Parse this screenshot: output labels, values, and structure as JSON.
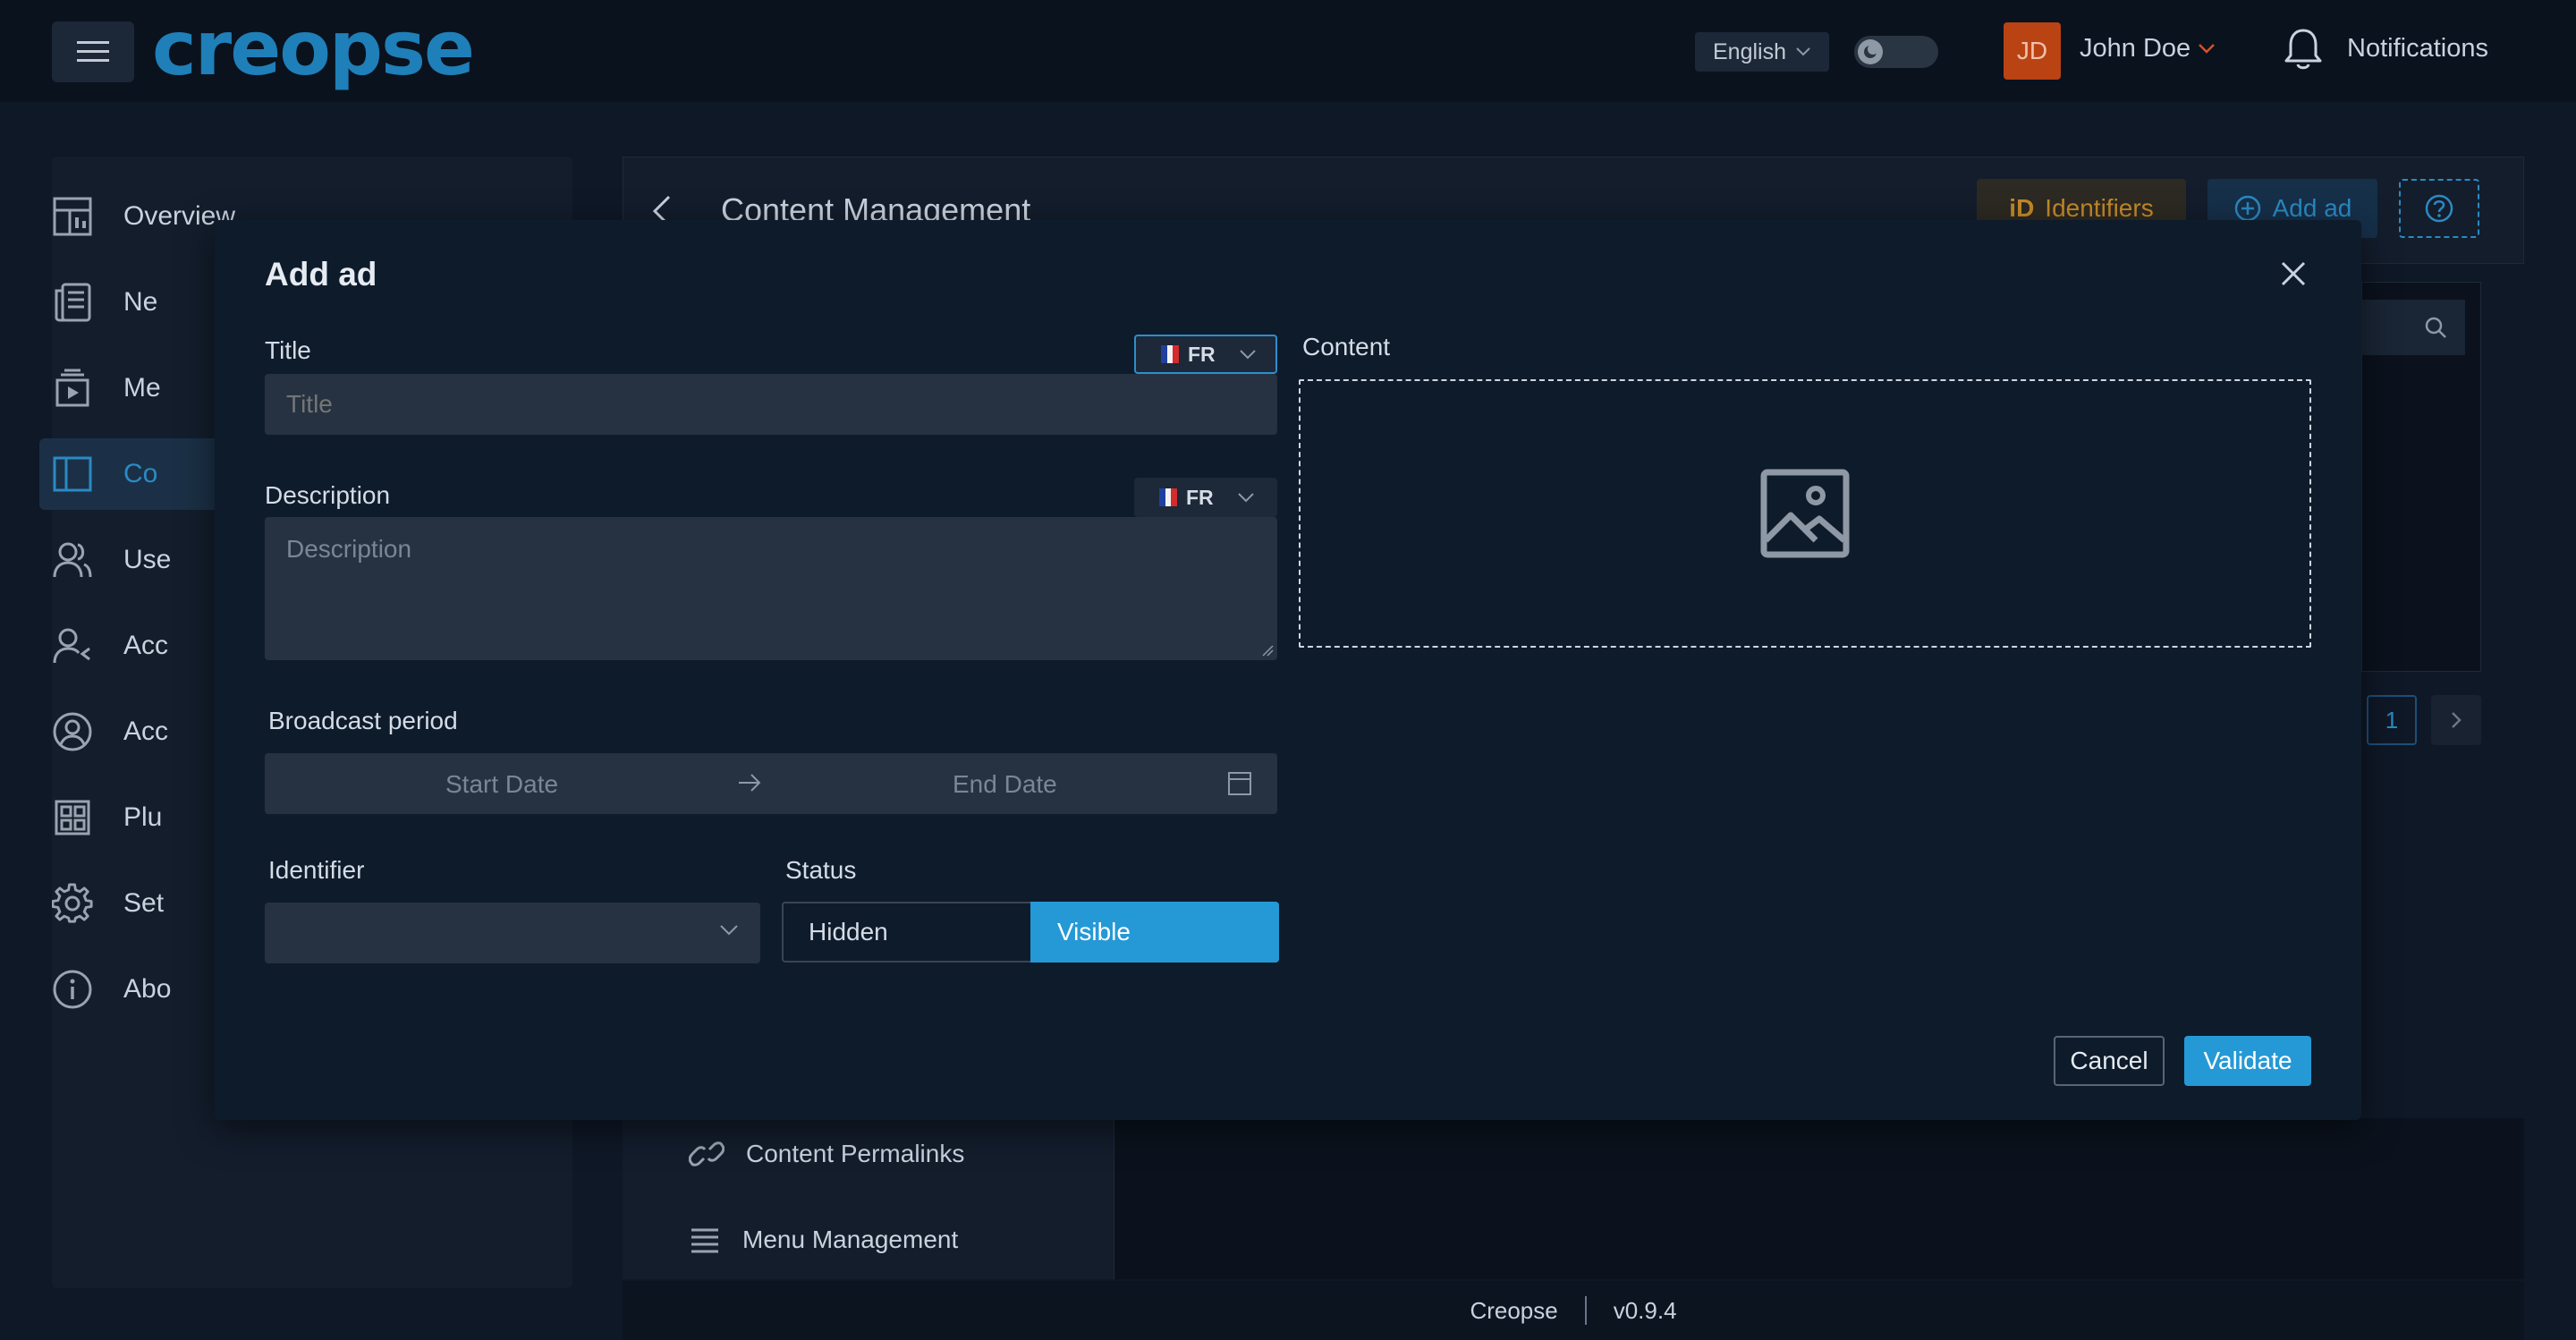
{
  "header": {
    "logo_text": "creopse",
    "language": "English",
    "user_initials": "JD",
    "user_name": "John Doe",
    "notifications_label": "Notifications"
  },
  "sidebar": {
    "items": [
      {
        "label": "Overview",
        "icon": "dashboard-icon"
      },
      {
        "label": "Ne",
        "icon": "newspaper-icon"
      },
      {
        "label": "Me",
        "icon": "media-icon"
      },
      {
        "label": "Co",
        "icon": "layout-icon",
        "active": true
      },
      {
        "label": "Use",
        "icon": "users-icon"
      },
      {
        "label": "Acc",
        "icon": "user-access-icon"
      },
      {
        "label": "Acc",
        "icon": "account-icon"
      },
      {
        "label": "Plu",
        "icon": "plugins-icon"
      },
      {
        "label": "Set",
        "icon": "gear-icon"
      },
      {
        "label": "Abo",
        "icon": "info-icon"
      }
    ]
  },
  "main": {
    "title": "Content Management",
    "identifiers_label": "Identifiers",
    "add_ad_label": "Add ad",
    "pager_current": "1",
    "sub_items": [
      {
        "label": "Content Permalinks",
        "icon": "link-icon"
      },
      {
        "label": "Menu Management",
        "icon": "menu-lines-icon"
      }
    ]
  },
  "footer": {
    "brand": "Creopse",
    "version": "v0.9.4"
  },
  "modal": {
    "title": "Add ad",
    "title_label": "Title",
    "title_placeholder": "Title",
    "title_lang": "FR",
    "description_label": "Description",
    "description_placeholder": "Description",
    "description_lang": "FR",
    "content_label": "Content",
    "broadcast_label": "Broadcast period",
    "start_placeholder": "Start Date",
    "end_placeholder": "End Date",
    "identifier_label": "Identifier",
    "status_label": "Status",
    "status_hidden": "Hidden",
    "status_visible": "Visible",
    "cancel_label": "Cancel",
    "validate_label": "Validate"
  },
  "colors": {
    "accent": "#2599d6",
    "brand": "#1f7fb8",
    "avatar_bg": "#b94313",
    "identifiers": "#c58a2a"
  }
}
